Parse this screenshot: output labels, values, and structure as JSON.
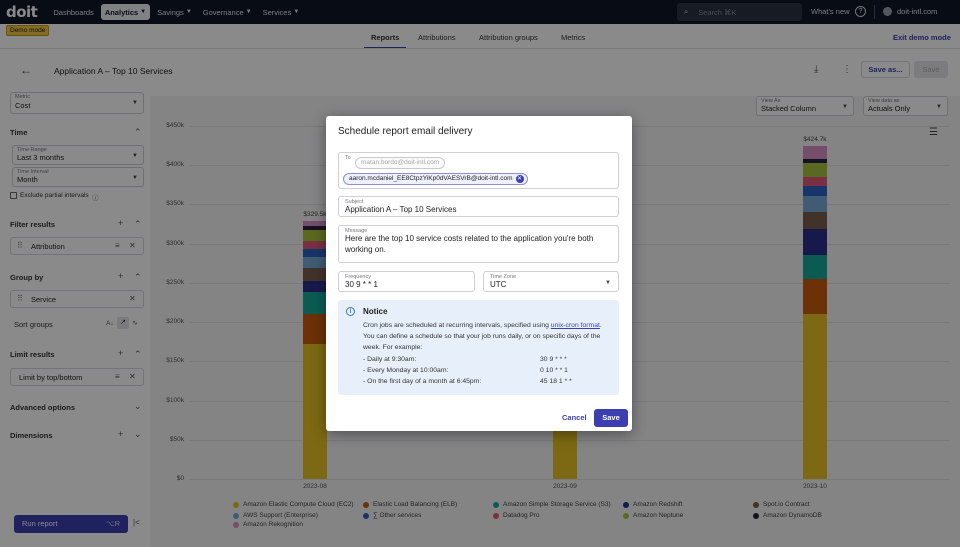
{
  "nav": {
    "logo": "doit",
    "items": [
      "Dashboards",
      "Analytics",
      "Savings",
      "Governance",
      "Services"
    ],
    "search_placeholder": "Search ⌘K",
    "whats_new": "What's new",
    "org": "doit-intl.com"
  },
  "demo_badge": "Demo mode",
  "tabs": [
    "Reports",
    "Attributions",
    "Attribution groups",
    "Metrics"
  ],
  "exit_demo": "Exit demo mode",
  "header": {
    "title": "Application A – Top 10 Services",
    "save_as": "Save as...",
    "save": "Save"
  },
  "sidebar": {
    "metric_label": "Metric",
    "metric_value": "Cost",
    "time_title": "Time",
    "time_range_label": "Time Range",
    "time_range_value": "Last 3 months",
    "time_interval_label": "Time Interval",
    "time_interval_value": "Month",
    "exclude_partial": "Exclude partial intervals",
    "filter_title": "Filter results",
    "filter_chip": "Attribution",
    "group_title": "Group by",
    "group_chip": "Service",
    "sort_groups": "Sort groups",
    "limit_title": "Limit results",
    "limit_chip": "Limit by top/bottom",
    "advanced": "Advanced options",
    "dimensions": "Dimensions",
    "run": "Run report",
    "run_kbd": "⌥R"
  },
  "view_as": {
    "label": "View As",
    "value": "Stacked Column"
  },
  "view_data_as": {
    "label": "View data as",
    "value": "Actuals Only"
  },
  "chart_data": {
    "type": "bar",
    "stacked": true,
    "categories": [
      "2023-08",
      "2023-09",
      "2023-10"
    ],
    "totals_labels": [
      "$329.5k",
      "",
      "$424.7k"
    ],
    "ylim": [
      0,
      450000
    ],
    "yticks": [
      "$0",
      "$50k",
      "$100k",
      "$150k",
      "$200k",
      "$250k",
      "$300k",
      "$350k",
      "$400k",
      "$450k"
    ],
    "ytick_values": [
      0,
      50000,
      100000,
      150000,
      200000,
      250000,
      300000,
      350000,
      400000,
      450000
    ],
    "grid": true,
    "legend_position": "bottom",
    "series": [
      {
        "name": "Amazon Elastic Compute Cloud (EC2)",
        "color": "#e8c224",
        "values": [
          172000,
          172000,
          210000
        ]
      },
      {
        "name": "Elastic Load Balancing (ELB)",
        "color": "#c75c0c",
        "values": [
          38000,
          38000,
          45000
        ]
      },
      {
        "name": "Amazon Simple Storage Service (S3)",
        "color": "#17a99a",
        "values": [
          28000,
          28000,
          31000
        ]
      },
      {
        "name": "Amazon Redshift",
        "color": "#2b2f8f",
        "values": [
          15000,
          15000,
          33000
        ]
      },
      {
        "name": "Spot.io Contract",
        "color": "#7a5e4e",
        "values": [
          16000,
          16000,
          22000
        ]
      },
      {
        "name": "AWS Support (Enterprise)",
        "color": "#78a8d8",
        "values": [
          14000,
          14000,
          20000
        ]
      },
      {
        "name": "Other services",
        "color": "#2e63c6",
        "values": [
          10000,
          10000,
          12000
        ]
      },
      {
        "name": "Datadog Pro",
        "color": "#e15a7a",
        "values": [
          10000,
          10000,
          12000
        ]
      },
      {
        "name": "Amazon Neptune",
        "color": "#a6c23a",
        "values": [
          14000,
          14000,
          18000
        ]
      },
      {
        "name": "Amazon DynamoDB",
        "color": "#2a2240",
        "values": [
          5000,
          5000,
          5000
        ]
      },
      {
        "name": "Amazon Rekognition",
        "color": "#d990c8",
        "values": [
          7500,
          7500,
          16700
        ]
      }
    ]
  },
  "modal": {
    "title": "Schedule report email delivery",
    "to_label": "To",
    "to_placeholder": "matan.bordo@doit-intl.com",
    "to_recipient": "aaron.mcdaniel_EE8CtpzYiKp0dVAESVrB@doit-intl.com",
    "subject_label": "Subject",
    "subject_value": "Application A – Top 10 Services",
    "message_label": "Message",
    "message_value": "Here are the top 10 service costs related to the application you're both working on.",
    "frequency_label": "Frequency",
    "frequency_value": "30 9 * * 1",
    "timezone_label": "Time Zone",
    "timezone_value": "UTC",
    "notice_title": "Notice",
    "notice_text_1": "Cron jobs are scheduled at recurring intervals, specified using ",
    "notice_link": "unix-cron format",
    "notice_text_2": ". You can define a schedule so that your job runs daily, or on specific days of the week. For example:",
    "examples": [
      {
        "desc": "- Daily at 9:30am:",
        "cron": "30 9 * * *"
      },
      {
        "desc": "- Every Monday at 10:00am:",
        "cron": "0 10 * * 1"
      },
      {
        "desc": "- On the first day of a month at 6:45pm:",
        "cron": "45 18 1 * *"
      }
    ],
    "cancel": "Cancel",
    "save": "Save"
  }
}
